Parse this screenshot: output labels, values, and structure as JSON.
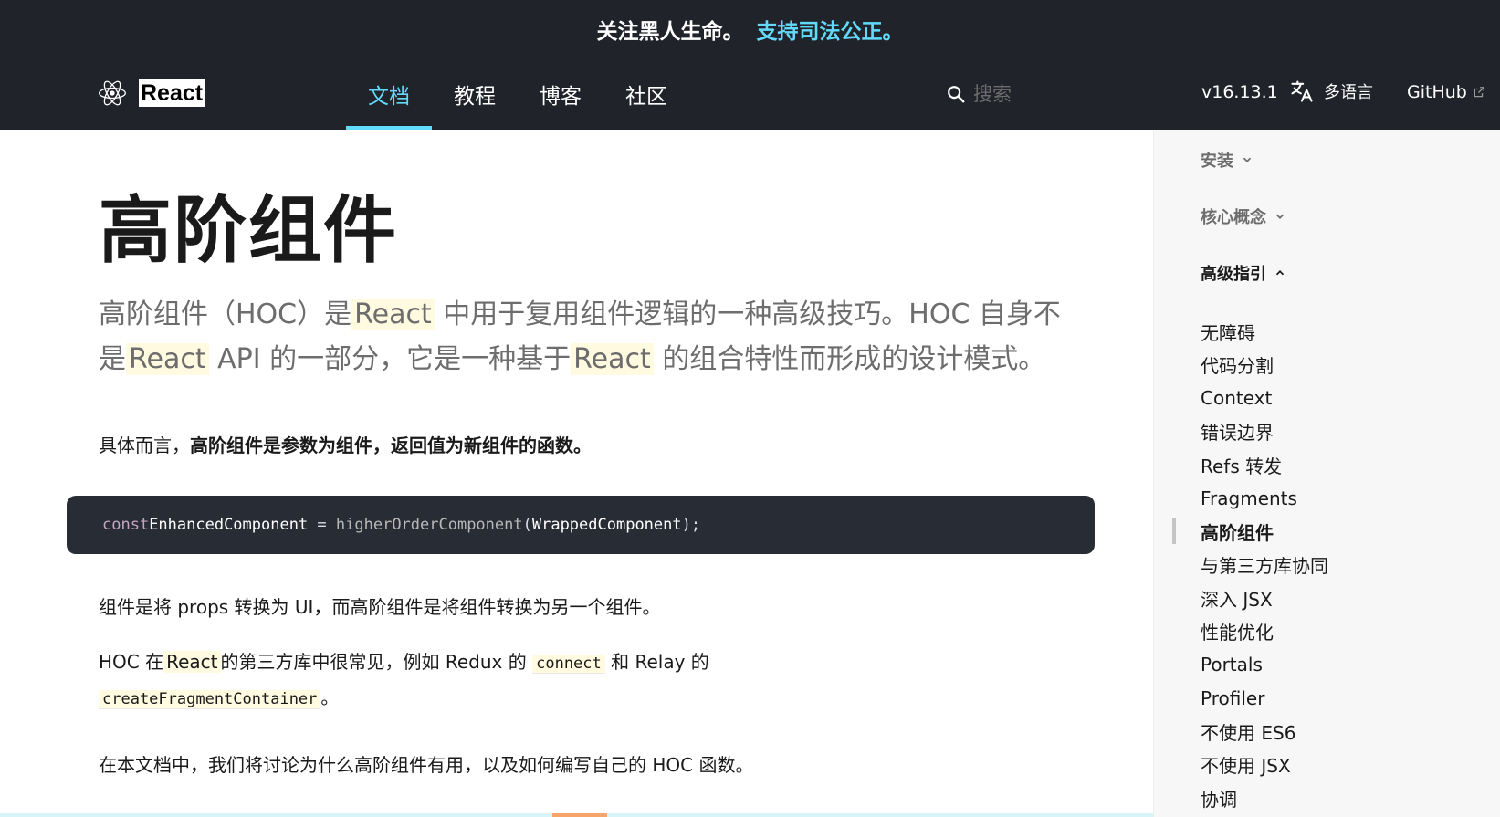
{
  "banner": {
    "text": "关注黑人生命。",
    "link": "支持司法公正。"
  },
  "header": {
    "brand": "React",
    "nav": [
      {
        "label": "文档",
        "active": true
      },
      {
        "label": "教程",
        "active": false
      },
      {
        "label": "博客",
        "active": false
      },
      {
        "label": "社区",
        "active": false
      }
    ],
    "search_placeholder": "搜索",
    "version": "v16.13.1",
    "language": "多语言",
    "github": "GitHub"
  },
  "main": {
    "title": "高阶组件",
    "intro": {
      "p1": "高阶组件（HOC）是",
      "react1": "React",
      "p2": "中用于复用组件逻辑的一种高级技巧。HOC 自身不是",
      "react2": "React",
      "p3": "API 的一部分，它是一种基于",
      "react3": "React",
      "p4": "的组合特性而形成的设计模式。"
    },
    "para1": {
      "prefix": "具体而言，",
      "bold": "高阶组件是参数为组件，返回值为新组件的函数。"
    },
    "code": {
      "kw": "const",
      "def": "EnhancedComponent",
      "op": " = ",
      "fn": "higherOrderComponent",
      "open": "(",
      "arg": "WrappedComponent",
      "close": ");"
    },
    "para2": "组件是将 props 转换为 UI，而高阶组件是将组件转换为另一个组件。",
    "para3": {
      "p1": "HOC 在",
      "react": "React",
      "p2": "的第三方库中很常见，例如 Redux 的",
      "code1": "connect",
      "p3": "和 Relay 的",
      "code2": "createFragmentContainer",
      "p4": "。"
    },
    "para4": "在本文档中，我们将讨论为什么高阶组件有用，以及如何编写自己的 HOC 函数。"
  },
  "sidebar": {
    "sections": [
      {
        "title": "安装",
        "open": false
      },
      {
        "title": "核心概念",
        "open": false
      },
      {
        "title": "高级指引",
        "open": true
      }
    ],
    "items": [
      "无障碍",
      "代码分割",
      "Context",
      "错误边界",
      "Refs 转发",
      "Fragments",
      "高阶组件",
      "与第三方库协同",
      "深入 JSX",
      "性能优化",
      "Portals",
      "Profiler",
      "不使用 ES6",
      "不使用 JSX",
      "协调"
    ],
    "active_item": "高阶组件"
  },
  "colors": {
    "header_bg": "#20232a",
    "accent": "#61dafb",
    "code_bg": "#282c34",
    "sidebar_bg": "#f7f7f7"
  },
  "icons": [
    "react-logo-icon",
    "search-icon",
    "translate-icon",
    "external-link-icon",
    "chevron-down-icon",
    "chevron-up-icon"
  ]
}
